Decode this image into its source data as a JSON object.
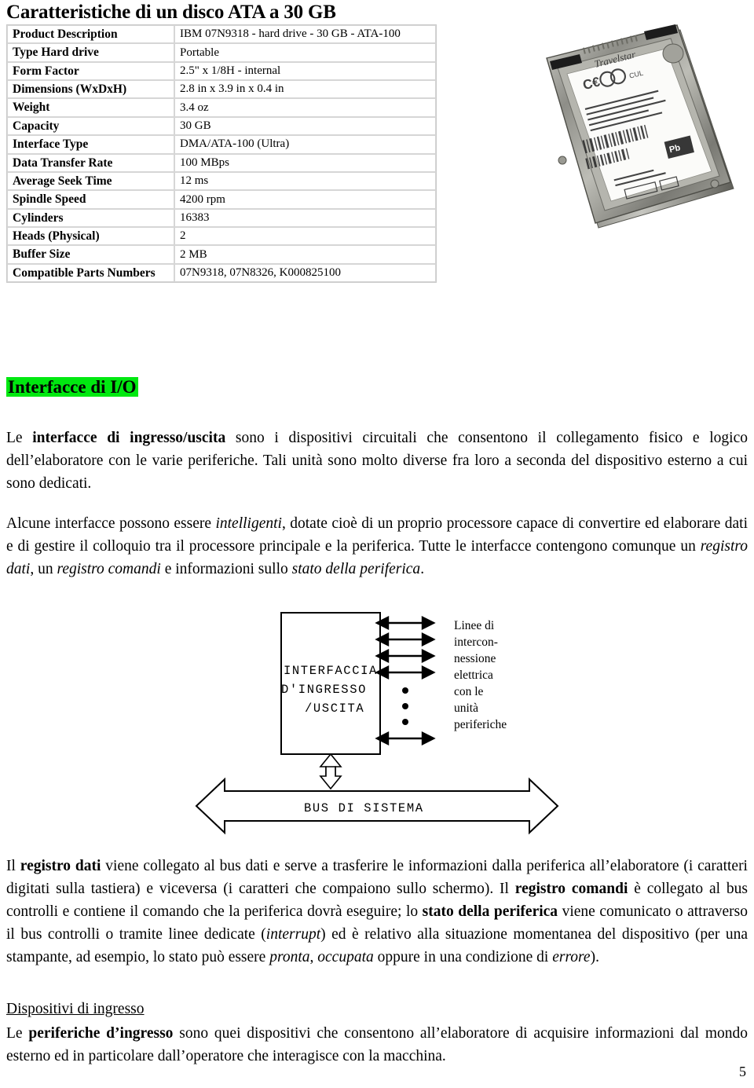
{
  "page": {
    "title": "Caratteristiche di un disco ATA a 30 GB",
    "number": "5"
  },
  "spec_table": {
    "rows": [
      {
        "key": "Product Description",
        "value": "IBM 07N9318 - hard drive - 30 GB - ATA-100"
      },
      {
        "key": "Type Hard drive",
        "value": "Portable"
      },
      {
        "key": "Form Factor",
        "value": "2.5\" x 1/8H - internal"
      },
      {
        "key": "Dimensions (WxDxH)",
        "value": "2.8 in x 3.9 in x 0.4 in"
      },
      {
        "key": "Weight",
        "value": "3.4 oz"
      },
      {
        "key": "Capacity",
        "value": "30 GB"
      },
      {
        "key": "Interface Type",
        "value": "DMA/ATA-100 (Ultra)"
      },
      {
        "key": "Data Transfer Rate",
        "value": "100 MBps"
      },
      {
        "key": "Average Seek Time",
        "value": "12 ms"
      },
      {
        "key": "Spindle Speed",
        "value": "4200 rpm"
      },
      {
        "key": "Cylinders",
        "value": "16383"
      },
      {
        "key": "Heads (Physical)",
        "value": "2"
      },
      {
        "key": "Buffer Size",
        "value": "2 MB"
      },
      {
        "key": "Compatible Parts Numbers",
        "value": "07N9318, 07N8326, K000825100"
      }
    ]
  },
  "photo": {
    "alt": "hard-drive-photo",
    "label": "Travelstar"
  },
  "section": {
    "heading": "Interfacce di I/O",
    "highlight_color": "#00e810"
  },
  "paragraphs": {
    "p1": {
      "a": "Le ",
      "bold1": "interfacce di ingresso/uscita",
      "b": " sono i dispositivi circuitali che consentono il collegamento fisico e logico dell’elaboratore con le varie periferiche. Tali unità sono molto diverse fra loro a seconda del dispositivo esterno a cui sono dedicati."
    },
    "p2": {
      "a": "Alcune interfacce possono essere ",
      "it1": "intelligenti",
      "b": ", dotate cioè di un proprio processore capace di convertire ed elaborare dati e di gestire il colloquio tra il processore principale e la periferica.",
      "c": "Tutte le interfacce contengono comunque un ",
      "it2": "registro dati",
      "d": ", un ",
      "it3": "registro comandi",
      "e": " e informazioni sullo ",
      "it4": "stato della periferica",
      "f": "."
    },
    "p4": {
      "a": "Il ",
      "bold1": "registro dati",
      "b": " viene collegato al bus dati e serve a trasferire le informazioni dalla periferica all’elaboratore (i caratteri digitati sulla tastiera) e viceversa (i caratteri che compaiono sullo schermo).",
      "c": "Il ",
      "bold2": "registro comandi",
      "d": " è collegato al bus controlli e contiene il comando che la periferica dovrà eseguire; lo ",
      "bold3": "stato della periferica",
      "e": " viene comunicato o attraverso il bus controlli o tramite linee dedicate (",
      "it1": "interrupt",
      "f": ") ed è relativo alla situazione momentanea del dispositivo (per una stampante, ad esempio, lo stato può essere ",
      "it2": "pronta",
      "g": ", ",
      "it3": "occupata",
      "h": " oppure in una condizione di ",
      "it4": "errore",
      "i": ")."
    },
    "sub_heading": "Dispositivi di ingresso",
    "p5": {
      "a": "Le ",
      "bold1": "periferiche d’ingresso",
      "b": " sono quei dispositivi che consentono all’elaboratore di acquisire informazioni dal mondo esterno ed in particolare dall’operatore che interagisce con la macchina."
    }
  },
  "diagram": {
    "box_lines": [
      "INTERFACCIA",
      "D'INGRESSO",
      "/USCITA"
    ],
    "bus_label": "BUS DI SISTEMA",
    "side_label_lines": [
      "Linee di",
      "intercon-",
      "nessione",
      "elettrica",
      "con le",
      "unità",
      "periferiche"
    ],
    "arrow_count_top": 4,
    "dot_count": 3,
    "arrow_count_bottom": 1
  }
}
